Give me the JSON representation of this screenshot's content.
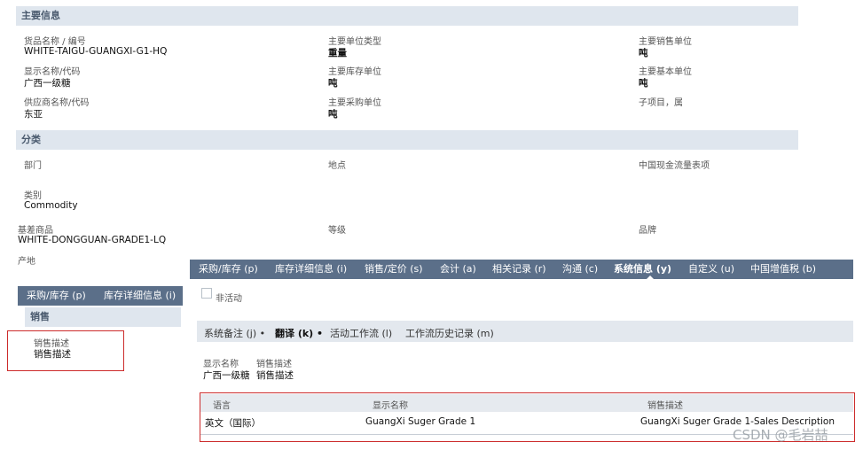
{
  "main_info": {
    "header": "主要信息",
    "fields": [
      {
        "label": "货品名称 / 编号",
        "value": "WHITE-TAIGU-GUANGXI-G1-HQ"
      },
      {
        "label": "主要单位类型",
        "value": "重量"
      },
      {
        "label": "主要销售单位",
        "value": "吨"
      },
      {
        "label": "显示名称/代码",
        "value": "广西一级糖"
      },
      {
        "label": "主要库存单位",
        "value": "吨"
      },
      {
        "label": "主要基本单位",
        "value": "吨"
      },
      {
        "label": "供应商名称/代码",
        "value": "东亚"
      },
      {
        "label": "主要采购单位",
        "value": "吨"
      },
      {
        "label": "子项目，属",
        "value": ""
      }
    ]
  },
  "classification": {
    "header": "分类",
    "fields": [
      {
        "label": "部门",
        "value": ""
      },
      {
        "label": "地点",
        "value": ""
      },
      {
        "label": "中国现金流量表项",
        "value": ""
      },
      {
        "label": "类别",
        "value": "Commodity"
      },
      {
        "label": "基差商品",
        "value": "WHITE-DONGGUAN-GRADE1-LQ"
      },
      {
        "label": "等级",
        "value": ""
      },
      {
        "label": "品牌",
        "value": ""
      },
      {
        "label": "产地",
        "value": ""
      }
    ]
  },
  "main_tabs": [
    "采购/库存 (p)",
    "库存详细信息 (i)",
    "销售/定价 (s)",
    "会计 (a)",
    "相关记录 (r)",
    "沟通 (c)",
    "系统信息 (y)",
    "自定义 (u)",
    "中国增值税 (b)"
  ],
  "inactive_label": "非活动",
  "sub_tabs": [
    "系统备注 (j) •",
    "翻译 (k) •",
    "活动工作流 (l)",
    "工作流历史记录 (m)"
  ],
  "translation": {
    "display_name_label": "显示名称",
    "display_name_value": "广西一级糖",
    "sales_desc_label": "销售描述",
    "sales_desc_value": "销售描述"
  },
  "grid": {
    "headers": [
      "语言",
      "显示名称",
      "销售描述"
    ],
    "rows": [
      [
        "英文（国际）",
        "GuangXi Suger Grade 1",
        "GuangXi Suger Grade 1-Sales Description"
      ]
    ]
  },
  "left_panel": {
    "tabs": [
      "采购/库存 (p)",
      "库存详细信息 (i)"
    ],
    "section": "销售",
    "field_label": "销售描述",
    "field_value": "销售描述"
  },
  "watermark": "CSDN @毛岩喆"
}
